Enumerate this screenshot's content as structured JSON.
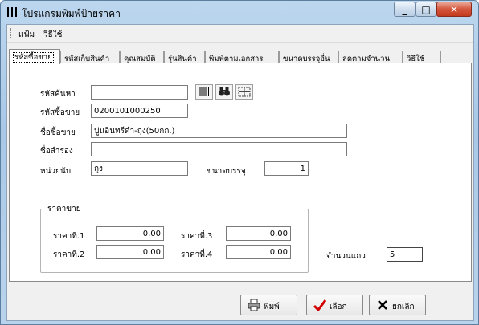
{
  "window": {
    "title": "โปรแกรมพิมพ์ป้ายราคา"
  },
  "menu": {
    "items": [
      "แฟ้ม",
      "วิธีใช้"
    ]
  },
  "tabs": [
    "รหัสซื้อขาย",
    "รหัสเก็บสินค้า",
    "คุณสมบัติ",
    "รุ่นสินค้า",
    "พิมพ์ตามเอกสาร",
    "ขนาดบรรจุอื่น",
    "ลดตามจำนวน",
    "วิธีใช้"
  ],
  "form": {
    "search_label": "รหัสค้นหา",
    "search_value": "",
    "sale_code_label": "รหัสซื้อขาย",
    "sale_code_value": "0200101000250",
    "sale_name_label": "ชื่อซื้อขาย",
    "sale_name_value": "ปูนอินทรีดำ-ถุง(50กก.)",
    "alt_name_label": "ชื่อสำรอง",
    "alt_name_value": "",
    "unit_label": "หน่วยนับ",
    "unit_value": "ถุง",
    "pack_size_label": "ขนาดบรรจุ",
    "pack_size_value": "1"
  },
  "prices": {
    "group_title": "ราคาขาย",
    "price1_label": "ราคาที่.1",
    "price1_value": "0.00",
    "price2_label": "ราคาที่.2",
    "price2_value": "0.00",
    "price3_label": "ราคาที่.3",
    "price3_value": "0.00",
    "price4_label": "ราคาที่.4",
    "price4_value": "0.00"
  },
  "rows": {
    "label": "จำนวนแถว",
    "value": "5"
  },
  "buttons": {
    "print": "พิมพ์",
    "select": "เลือก",
    "cancel": "ยกเลิก"
  },
  "icons": [
    "barcode-icon",
    "binoculars-icon",
    "grid-select-icon",
    "printer-icon",
    "checkmark-icon",
    "cross-icon"
  ],
  "colors": {
    "titlebar": "#a9c8e6",
    "close_button": "#c23a1e",
    "check": "#d10000"
  }
}
